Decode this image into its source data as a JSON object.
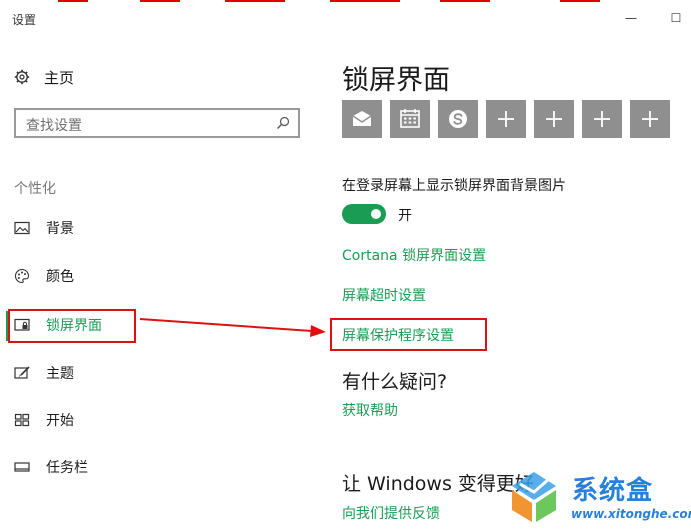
{
  "window": {
    "title": "设置",
    "minimize_glyph": "—",
    "maximize_glyph": "☐"
  },
  "sidebar": {
    "home": {
      "label": "主页",
      "icon": "gear-icon"
    },
    "search": {
      "placeholder": "查找设置",
      "icon": "search-icon"
    },
    "section": "个性化",
    "items": [
      {
        "label": "背景",
        "icon": "picture-icon",
        "selected": false
      },
      {
        "label": "颜色",
        "icon": "palette-icon",
        "selected": false
      },
      {
        "label": "锁屏界面",
        "icon": "lock-screen-icon",
        "selected": true
      },
      {
        "label": "主题",
        "icon": "brush-icon",
        "selected": false
      },
      {
        "label": "开始",
        "icon": "start-grid-icon",
        "selected": false
      },
      {
        "label": "任务栏",
        "icon": "taskbar-icon",
        "selected": false
      }
    ]
  },
  "main": {
    "title": "锁屏界面",
    "apps": [
      {
        "icon": "mail-icon"
      },
      {
        "icon": "calendar-icon"
      },
      {
        "icon": "skype-icon"
      },
      {
        "icon": "plus-icon"
      },
      {
        "icon": "plus-icon"
      },
      {
        "icon": "plus-icon"
      },
      {
        "icon": "plus-icon"
      }
    ],
    "lock_bg_setting": {
      "label": "在登录屏幕上显示锁屏界面背景图片",
      "state_label": "开",
      "on": true
    },
    "links": {
      "cortana": "Cortana 锁屏界面设置",
      "screen_timeout": "屏幕超时设置",
      "screensaver": "屏幕保护程序设置"
    },
    "help": {
      "heading": "有什么疑问?",
      "link": "获取帮助"
    },
    "feedback": {
      "heading": "让 Windows 变得更好",
      "link": "向我们提供反馈"
    }
  },
  "colors": {
    "accent": "#1a9c54",
    "annotation": "#e01010",
    "tile": "#8f8f8f"
  },
  "watermark": {
    "name": "系统盒",
    "url": "www.xitonghe.com"
  }
}
